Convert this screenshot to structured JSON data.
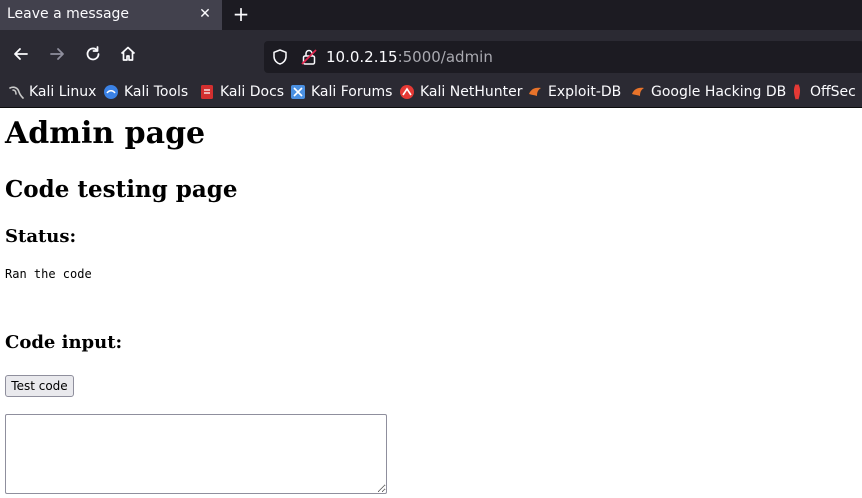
{
  "browser": {
    "tab": {
      "title": "Leave a message",
      "close_glyph": "✕"
    },
    "new_tab_glyph": "+",
    "nav": {
      "back_icon": "arrow-left-icon",
      "forward_icon": "arrow-right-icon",
      "reload_icon": "reload-icon",
      "home_icon": "home-icon"
    },
    "url": {
      "host": "10.0.2.15",
      "rest": ":5000/admin"
    },
    "bookmarks": [
      {
        "label": "Kali Linux",
        "icon": "kali-dragon-icon",
        "color": "#c8c8c8"
      },
      {
        "label": "Kali Tools",
        "icon": "kali-tools-icon",
        "color": "#3b82e6"
      },
      {
        "label": "Kali Docs",
        "icon": "kali-docs-icon",
        "color": "#d32f2f"
      },
      {
        "label": "Kali Forums",
        "icon": "kali-forums-icon",
        "color": "#4a90e2"
      },
      {
        "label": "Kali NetHunter",
        "icon": "kali-nethunter-icon",
        "color": "#e53935"
      },
      {
        "label": "Exploit-DB",
        "icon": "exploit-db-icon",
        "color": "#e8732a"
      },
      {
        "label": "Google Hacking DB",
        "icon": "ghdb-icon",
        "color": "#e8732a"
      },
      {
        "label": "OffSec",
        "icon": "offsec-icon",
        "color": "#e53935"
      }
    ]
  },
  "page": {
    "title": "Admin page",
    "subtitle": "Code testing page",
    "status_heading": "Status:",
    "status_text": "Ran the code",
    "code_heading": "Code input:",
    "test_button": "Test code",
    "code_value": ""
  }
}
